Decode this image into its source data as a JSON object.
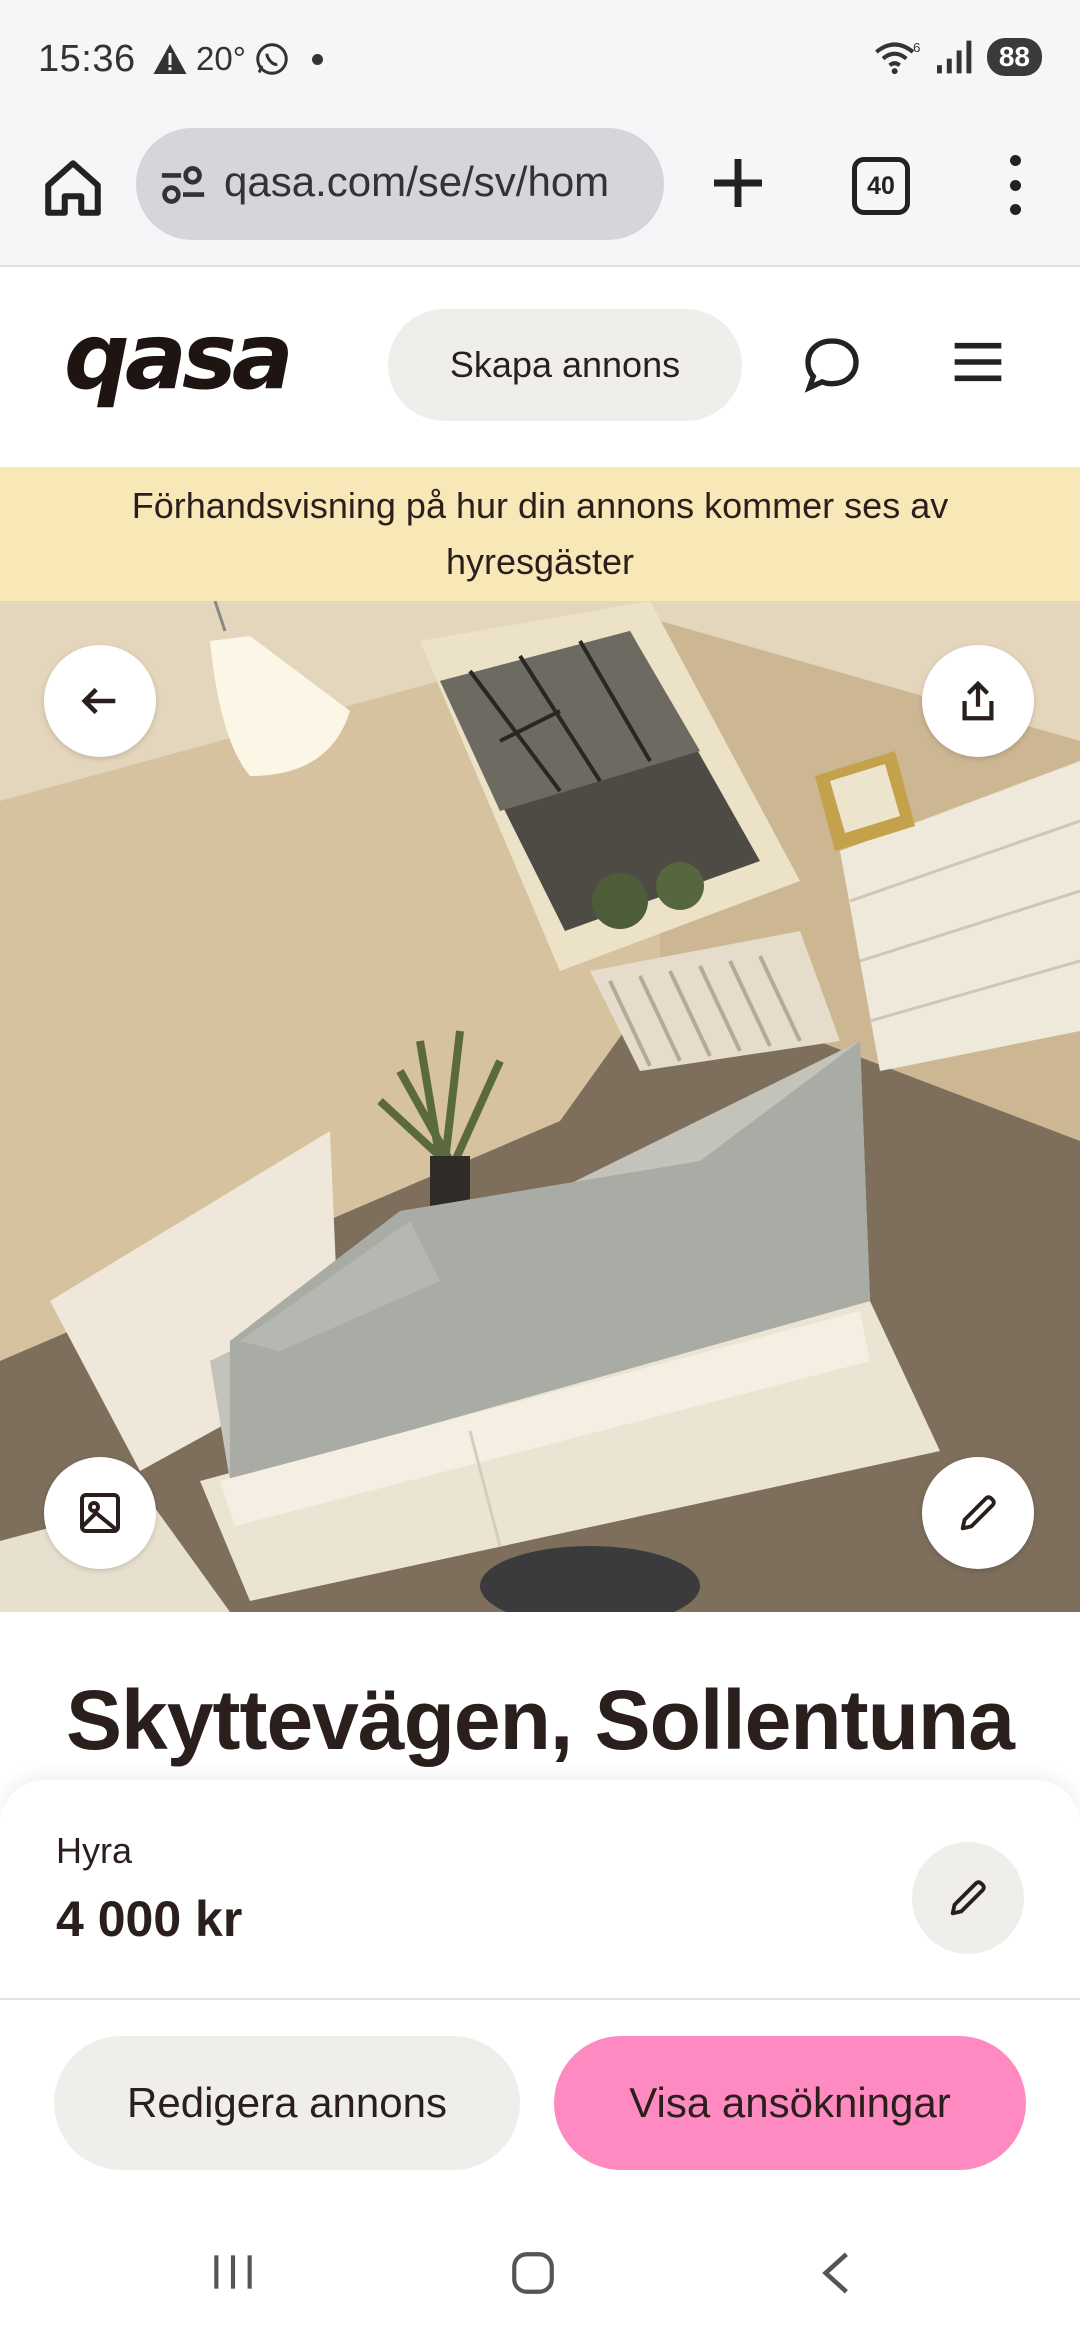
{
  "status_bar": {
    "time": "15:36",
    "temperature": "20°",
    "network_label": "6",
    "battery": "88"
  },
  "browser": {
    "url": "qasa.com/se/sv/hom",
    "tab_count": "40"
  },
  "site": {
    "logo": "qasa",
    "create_listing_label": "Skapa annons"
  },
  "banner": {
    "text": "Förhandsvisning på hur din annons kommer ses av hyresgäster"
  },
  "listing": {
    "title": "Skyttevägen, Sollentuna",
    "rent_label": "Hyra",
    "rent_value": "4 000 kr"
  },
  "actions": {
    "edit_listing_label": "Redigera annons",
    "show_applications_label": "Visa ansökningar"
  },
  "colors": {
    "accent_pink": "#ff8ac1",
    "banner_yellow": "#f8e8b8",
    "pill_gray": "#efeeea",
    "text_dark": "#2a1f1c"
  }
}
